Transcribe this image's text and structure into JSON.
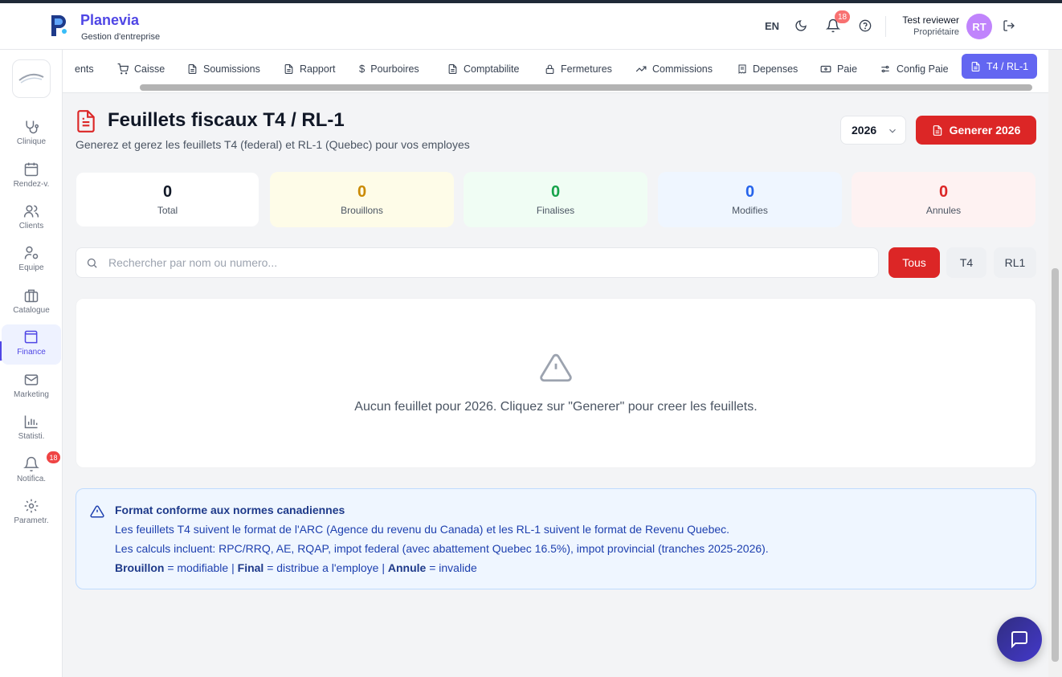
{
  "app": {
    "name": "Planevia",
    "subtitle": "Gestion d'entreprise",
    "brand_color": "#4f46e5"
  },
  "header": {
    "lang": "EN",
    "notif_count": "18",
    "user_name": "Test reviewer",
    "user_role": "Propriétaire",
    "avatar_initials": "RT"
  },
  "sidebar": {
    "items": [
      {
        "label": "Clinique",
        "icon": "stethoscope-icon"
      },
      {
        "label": "Rendez-v.",
        "icon": "calendar-icon"
      },
      {
        "label": "Clients",
        "icon": "users-icon"
      },
      {
        "label": "Equipe",
        "icon": "team-icon"
      },
      {
        "label": "Catalogue",
        "icon": "briefcase-icon"
      },
      {
        "label": "Finance",
        "icon": "wallet-icon",
        "active": true
      },
      {
        "label": "Marketing",
        "icon": "mail-icon"
      },
      {
        "label": "Statisti.",
        "icon": "bar-chart-icon"
      },
      {
        "label": "Notifica.",
        "icon": "bell-icon",
        "badge": "18"
      },
      {
        "label": "Parametr.",
        "icon": "gear-icon"
      }
    ]
  },
  "tabs": [
    {
      "label": "ents"
    },
    {
      "label": "Caisse",
      "icon": "cart-icon"
    },
    {
      "label": "Soumissions",
      "icon": "document-icon"
    },
    {
      "label": "Rapport",
      "icon": "document-icon"
    },
    {
      "label": "Pourboires",
      "icon": "dollar-icon"
    },
    {
      "label": "Comptabilite",
      "icon": "document-icon"
    },
    {
      "label": "Fermetures",
      "icon": "lock-icon"
    },
    {
      "label": "Commissions",
      "icon": "trend-icon"
    },
    {
      "label": "Depenses",
      "icon": "receipt-icon"
    },
    {
      "label": "Paie",
      "icon": "cash-icon"
    },
    {
      "label": "Config Paie",
      "icon": "sliders-icon"
    },
    {
      "label": "T4 / RL-1",
      "icon": "document-icon",
      "active": true
    }
  ],
  "page": {
    "title": "Feuillets fiscaux T4 / RL-1",
    "subtitle": "Generez et gerez les feuillets T4 (federal) et RL-1 (Quebec) pour vos employes",
    "year": "2026",
    "generate_label": "Generer 2026"
  },
  "stats": [
    {
      "value": "0",
      "label": "Total",
      "color": "#111827",
      "bg": "#ffffff"
    },
    {
      "value": "0",
      "label": "Brouillons",
      "color": "#ca8a04",
      "bg": "#fefce8"
    },
    {
      "value": "0",
      "label": "Finalises",
      "color": "#16a34a",
      "bg": "#f0fdf4"
    },
    {
      "value": "0",
      "label": "Modifies",
      "color": "#2563eb",
      "bg": "#eff6ff"
    },
    {
      "value": "0",
      "label": "Annules",
      "color": "#dc2626",
      "bg": "#fef2f2"
    }
  ],
  "search": {
    "placeholder": "Rechercher par nom ou numero..."
  },
  "filters": [
    {
      "label": "Tous",
      "active": true
    },
    {
      "label": "T4"
    },
    {
      "label": "RL1"
    }
  ],
  "empty": {
    "message": "Aucun feuillet pour 2026. Cliquez sur \"Generer\" pour creer les feuillets."
  },
  "info": {
    "title": "Format conforme aux normes canadiennes",
    "line1": "Les feuillets T4 suivent le format de l'ARC (Agence du revenu du Canada) et les RL-1 suivent le format de Revenu Quebec.",
    "line2": "Les calculs incluent: RPC/RRQ, AE, RQAP, impot federal (avec abattement Quebec 16.5%), impot provincial (tranches 2025-2026).",
    "legend": [
      {
        "term": "Brouillon",
        "desc": "= modifiable"
      },
      {
        "term": "Final",
        "desc": "= distribue a l'employe"
      },
      {
        "term": "Annule",
        "desc": "= invalide"
      }
    ],
    "separator": "|"
  }
}
